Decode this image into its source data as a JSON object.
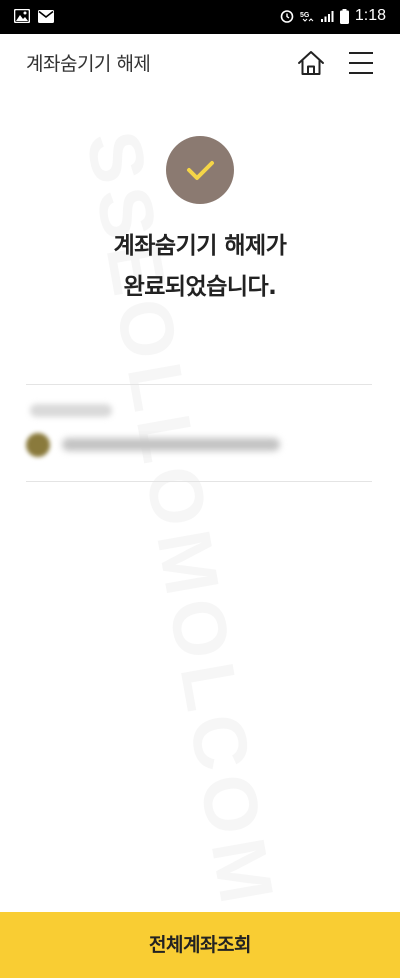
{
  "status_bar": {
    "time": "1:18",
    "left_icons": [
      "image-icon",
      "mail-icon"
    ],
    "right_icons": [
      "alarm-icon",
      "5g-icon",
      "signal-icon",
      "battery-icon"
    ]
  },
  "header": {
    "title": "계좌숨기기 해제",
    "home_icon": "home-icon",
    "menu_icon": "menu-icon"
  },
  "result": {
    "icon": "check-icon",
    "message_line1": "계좌숨기기 해제가",
    "message_line2": "완료되었습니다."
  },
  "account": {
    "label": "",
    "number": ""
  },
  "bottom": {
    "button_label": "전체계좌조회"
  },
  "colors": {
    "accent": "#f9cd33",
    "check_circle": "#8b7a71",
    "check_mark": "#f5d547",
    "status_bar": "#000000"
  }
}
